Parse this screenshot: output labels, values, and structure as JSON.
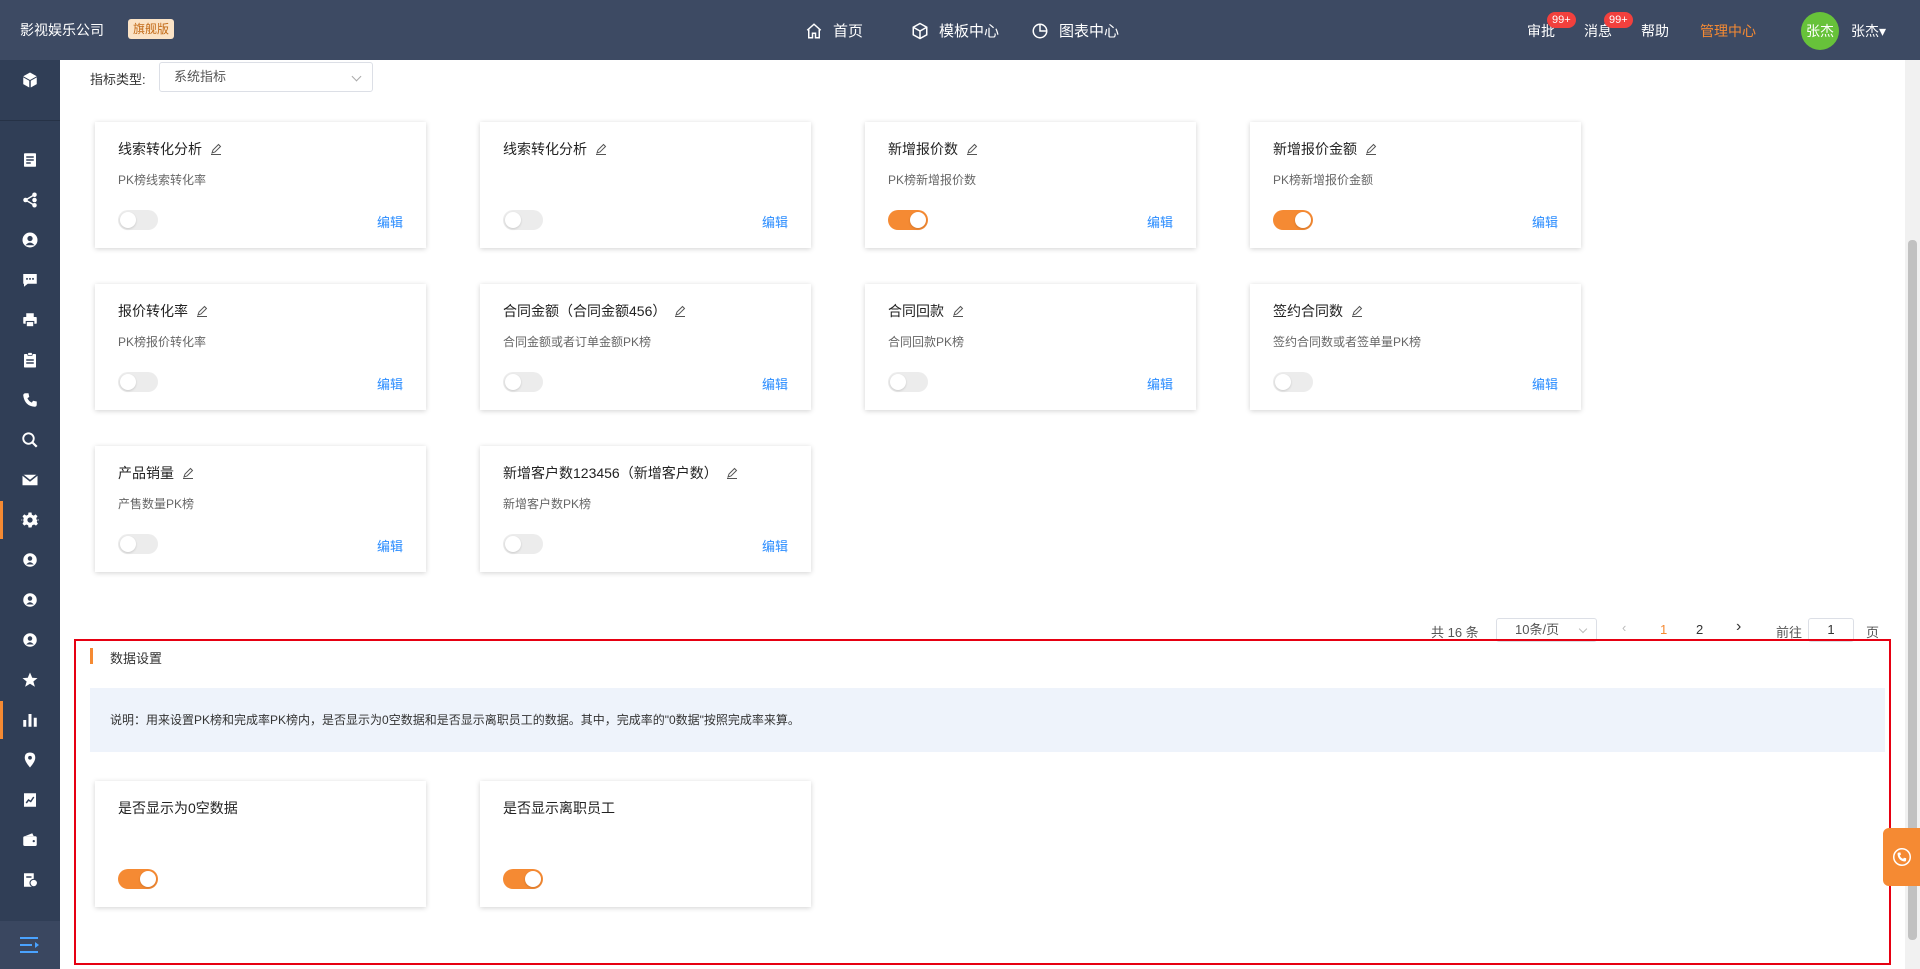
{
  "header": {
    "brand": "影视娱乐公司",
    "brand_tag": "旗舰版",
    "nav": [
      {
        "label": "首页",
        "icon": "home-icon"
      },
      {
        "label": "模板中心",
        "icon": "cube-icon"
      },
      {
        "label": "图表中心",
        "icon": "pie-chart-icon"
      }
    ],
    "approve": "审批",
    "approve_badge": "99+",
    "messages": "消息",
    "messages_badge": "99+",
    "help": "帮助",
    "admin": "管理中心",
    "avatar_text": "张杰",
    "user_name": "张杰▾"
  },
  "sidebar": {
    "icons": [
      "cube-icon",
      "document-icon",
      "org-tree-icon",
      "user-icon",
      "chat-icon",
      "printer-icon",
      "clipboard-icon",
      "phone-icon",
      "search-icon",
      "mail-icon",
      "gear-icon",
      "user-icon",
      "user-icon",
      "user-icon",
      "star-icon",
      "bar-chart-icon",
      "location-icon",
      "report-icon",
      "wallet-icon",
      "invoice-icon"
    ],
    "active": "gear-icon"
  },
  "filter": {
    "label": "指标类型:",
    "value": "系统指标"
  },
  "cards": [
    {
      "title": "线索转化分析",
      "desc": "PK榜线索转化率",
      "on": false
    },
    {
      "title": "线索转化分析",
      "desc": "",
      "on": false
    },
    {
      "title": "新增报价数",
      "desc": "PK榜新增报价数",
      "on": true
    },
    {
      "title": "新增报价金额",
      "desc": "PK榜新增报价金额",
      "on": true
    },
    {
      "title": "报价转化率",
      "desc": "PK榜报价转化率",
      "on": false
    },
    {
      "title": "合同金额（合同金额456）",
      "desc": "合同金额或者订单金额PK榜",
      "on": false
    },
    {
      "title": "合同回款",
      "desc": "合同回款PK榜",
      "on": false
    },
    {
      "title": "签约合同数",
      "desc": "签约合同数或者签单量PK榜",
      "on": false
    },
    {
      "title": "产品销量",
      "desc": "产售数量PK榜",
      "on": false
    },
    {
      "title": "新增客户数123456（新增客户数）",
      "desc": "新增客户数PK榜",
      "on": false
    }
  ],
  "edit_label": "编辑",
  "pagination": {
    "total": "共 16 条",
    "page_size": "10条/页",
    "pages": [
      "1",
      "2"
    ],
    "current": "1",
    "goto_label": "前往",
    "goto_value": "1",
    "page_suffix": "页"
  },
  "data_settings": {
    "title": "数据设置",
    "note": "说明：用来设置PK榜和完成率PK榜内，是否显示为0空数据和是否显示离职员工的数据。其中，完成率的\"0数据\"按照完成率来算。",
    "items": [
      {
        "title": "是否显示为0空数据",
        "on": true
      },
      {
        "title": "是否显示离职员工",
        "on": true
      }
    ]
  },
  "colors": {
    "accent": "#f58a33",
    "topbar": "#3d4a63",
    "sidebar": "#303e56",
    "link": "#2a8cff",
    "highlight": "#e60012"
  }
}
